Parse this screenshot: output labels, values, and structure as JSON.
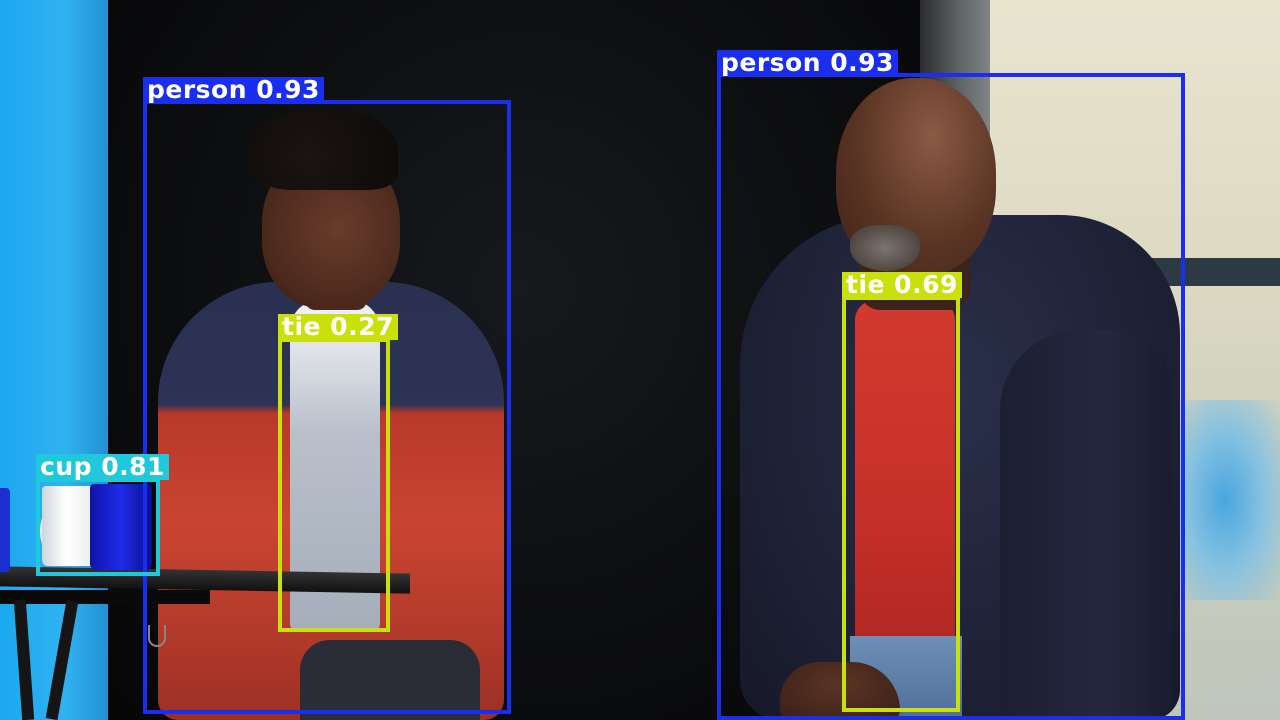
{
  "scene": {
    "description_visible": false
  },
  "colors": {
    "person": "#1a2ef0",
    "tie": "#c9e00b",
    "cup": "#21c8dc",
    "label_text": "#ffffff"
  },
  "detections": [
    {
      "class": "person",
      "score": "0.93",
      "label": "person 0.93",
      "color_key": "person"
    },
    {
      "class": "person",
      "score": "0.93",
      "label": "person 0.93",
      "color_key": "person"
    },
    {
      "class": "tie",
      "score": "0.27",
      "label": "tie 0.27",
      "color_key": "tie"
    },
    {
      "class": "tie",
      "score": "0.69",
      "label": "tie 0.69",
      "color_key": "tie"
    },
    {
      "class": "cup",
      "score": "0.81",
      "label": "cup 0.81",
      "color_key": "cup"
    }
  ]
}
